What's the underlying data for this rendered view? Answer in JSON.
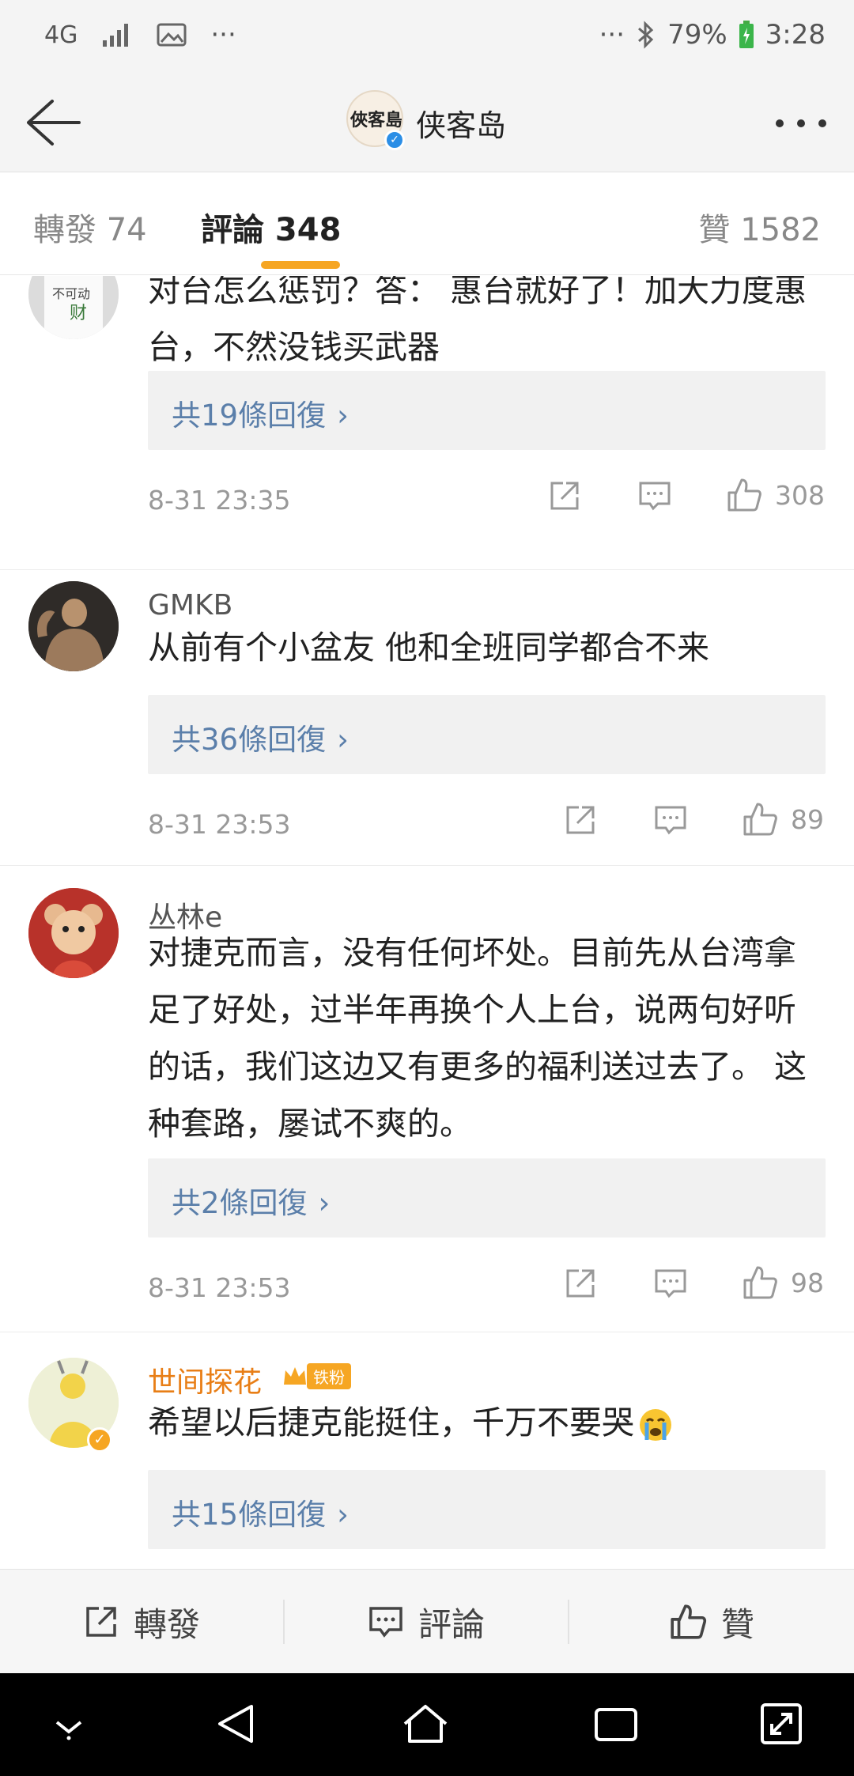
{
  "status_bar": {
    "network": "4G",
    "battery": "79%",
    "time": "3:28",
    "more_dots": "···"
  },
  "header": {
    "title": "侠客岛",
    "logo_text": "俠客島"
  },
  "tabs": {
    "repost": "轉發 74",
    "comments": "評論 348",
    "likes": "贊 1582"
  },
  "comments": [
    {
      "username": "",
      "text": "对台怎么惩罚？答： 惠台就好了！加大力度惠台，不然没钱买武器",
      "replies_label": "共19條回復",
      "time": "8-31 23:35",
      "likes": "308"
    },
    {
      "username": "GMKB",
      "text": "从前有个小盆友 他和全班同学都合不来",
      "replies_label": "共36條回復",
      "time": "8-31 23:53",
      "likes": "89"
    },
    {
      "username": "丛林e",
      "text": "对捷克而言，没有任何坏处。目前先从台湾拿足了好处，过半年再换个人上台，说两句好听的话，我们这边又有更多的福利送过去了。 这种套路，屡试不爽的。",
      "replies_label": "共2條回復",
      "time": "8-31 23:53",
      "likes": "98"
    },
    {
      "username": "世间探花",
      "badge": "铁粉",
      "text": "希望以后捷克能挺住，千万不要哭",
      "replies_label": "共15條回復"
    }
  ],
  "bottom_bar": {
    "repost": "轉發",
    "comment": "評論",
    "like": "贊"
  },
  "colors": {
    "accent": "#f6a623",
    "link": "#5b7faa",
    "vip_name": "#e87e16",
    "verify": "#2b8ee6"
  },
  "icons": [
    "back-arrow-icon",
    "more-icon",
    "share-icon",
    "comment-icon",
    "like-icon",
    "chevron-right-icon",
    "nav-down-icon",
    "nav-back-icon",
    "nav-home-icon",
    "nav-recents-icon",
    "nav-expand-icon"
  ]
}
